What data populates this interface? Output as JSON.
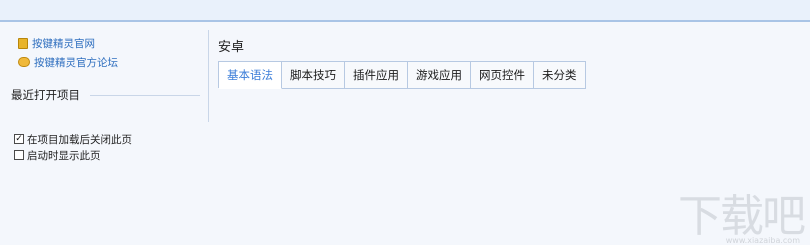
{
  "links": [
    {
      "label": "按键精灵官网",
      "icon": "document-icon"
    },
    {
      "label": "按键精灵官方论坛",
      "icon": "chat-bubble-icon"
    }
  ],
  "recent": {
    "title": "最近打开项目"
  },
  "options": [
    {
      "label": "在项目加载后关闭此页",
      "checked": true
    },
    {
      "label": "启动时显示此页",
      "checked": false
    }
  ],
  "main": {
    "title": "安卓",
    "tabs": [
      {
        "label": "基本语法",
        "active": true
      },
      {
        "label": "脚本技巧",
        "active": false
      },
      {
        "label": "插件应用",
        "active": false
      },
      {
        "label": "游戏应用",
        "active": false
      },
      {
        "label": "网页控件",
        "active": false
      },
      {
        "label": "未分类",
        "active": false
      }
    ]
  },
  "watermark": {
    "text": "下载吧",
    "sub": "www.xiazaiba.com"
  },
  "colors": {
    "accent": "#3b7dd8",
    "link": "#2f6fbf",
    "background": "#f4f7fc"
  }
}
